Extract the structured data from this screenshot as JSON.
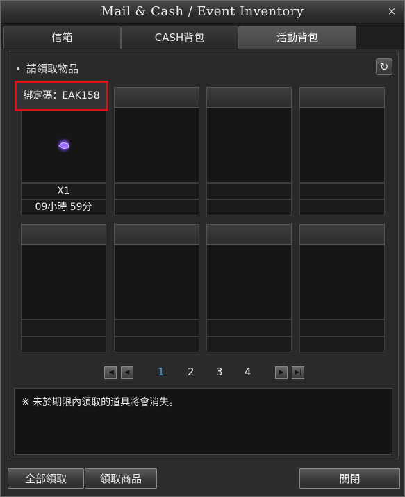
{
  "window": {
    "title": "Mail & Cash / Event Inventory",
    "close_glyph": "×"
  },
  "tabs": [
    {
      "label": "信箱",
      "active": false
    },
    {
      "label": "CASH背包",
      "active": false
    },
    {
      "label": "活動背包",
      "active": true
    }
  ],
  "section": {
    "label": "請領取物品",
    "refresh_icon": "refresh-icon"
  },
  "slots": [
    {
      "binding_code": "綁定碼：EAK158",
      "quantity": "X1",
      "time_left": "09小時 59分",
      "icon": "purple-gem-icon"
    },
    {},
    {},
    {},
    {},
    {},
    {},
    {}
  ],
  "pagination": {
    "pages": [
      "1",
      "2",
      "3",
      "4"
    ],
    "current": "1"
  },
  "notice": "※ 未於期限內領取的道具將會消失。",
  "buttons": {
    "claim_all": "全部領取",
    "claim_item": "領取商品",
    "close": "關閉"
  },
  "colors": {
    "highlight_border": "#e01010",
    "current_page": "#4aa3e0"
  }
}
